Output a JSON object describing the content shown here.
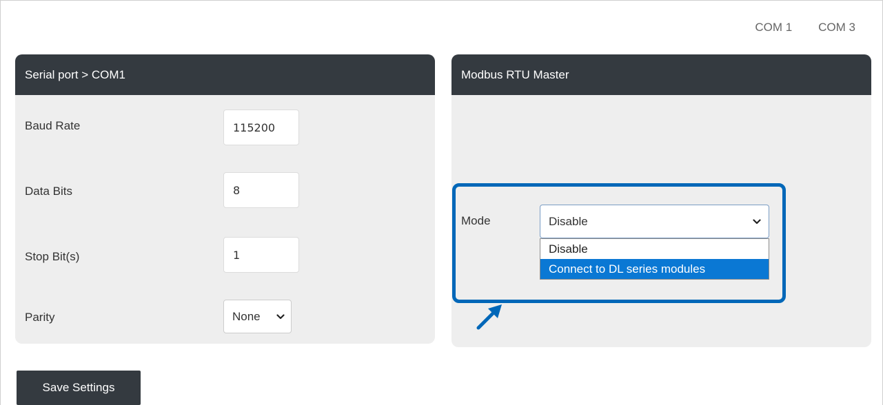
{
  "com_tabs": [
    "COM 1",
    "COM 3"
  ],
  "serial_panel": {
    "title": "Serial port > COM1",
    "baud_rate": {
      "label": "Baud Rate",
      "value": "115200"
    },
    "data_bits": {
      "label": "Data Bits",
      "value": "8"
    },
    "stop_bits": {
      "label": "Stop Bit(s)",
      "value": "1"
    },
    "parity": {
      "label": "Parity",
      "selected": "None"
    }
  },
  "modbus_panel": {
    "title": "Modbus RTU Master",
    "mode": {
      "label": "Mode",
      "selected": "Disable",
      "options": [
        "Disable",
        "Connect to DL series modules"
      ],
      "highlighted_option": "Connect to DL series modules"
    }
  },
  "save_label": "Save Settings",
  "colors": {
    "header_bg": "#343a40",
    "panel_bg": "#eeeeee",
    "highlight_border": "#0067b8",
    "option_highlight": "#0a78d4"
  },
  "icons": [
    "chevron-down-icon",
    "callout-arrow-icon"
  ]
}
